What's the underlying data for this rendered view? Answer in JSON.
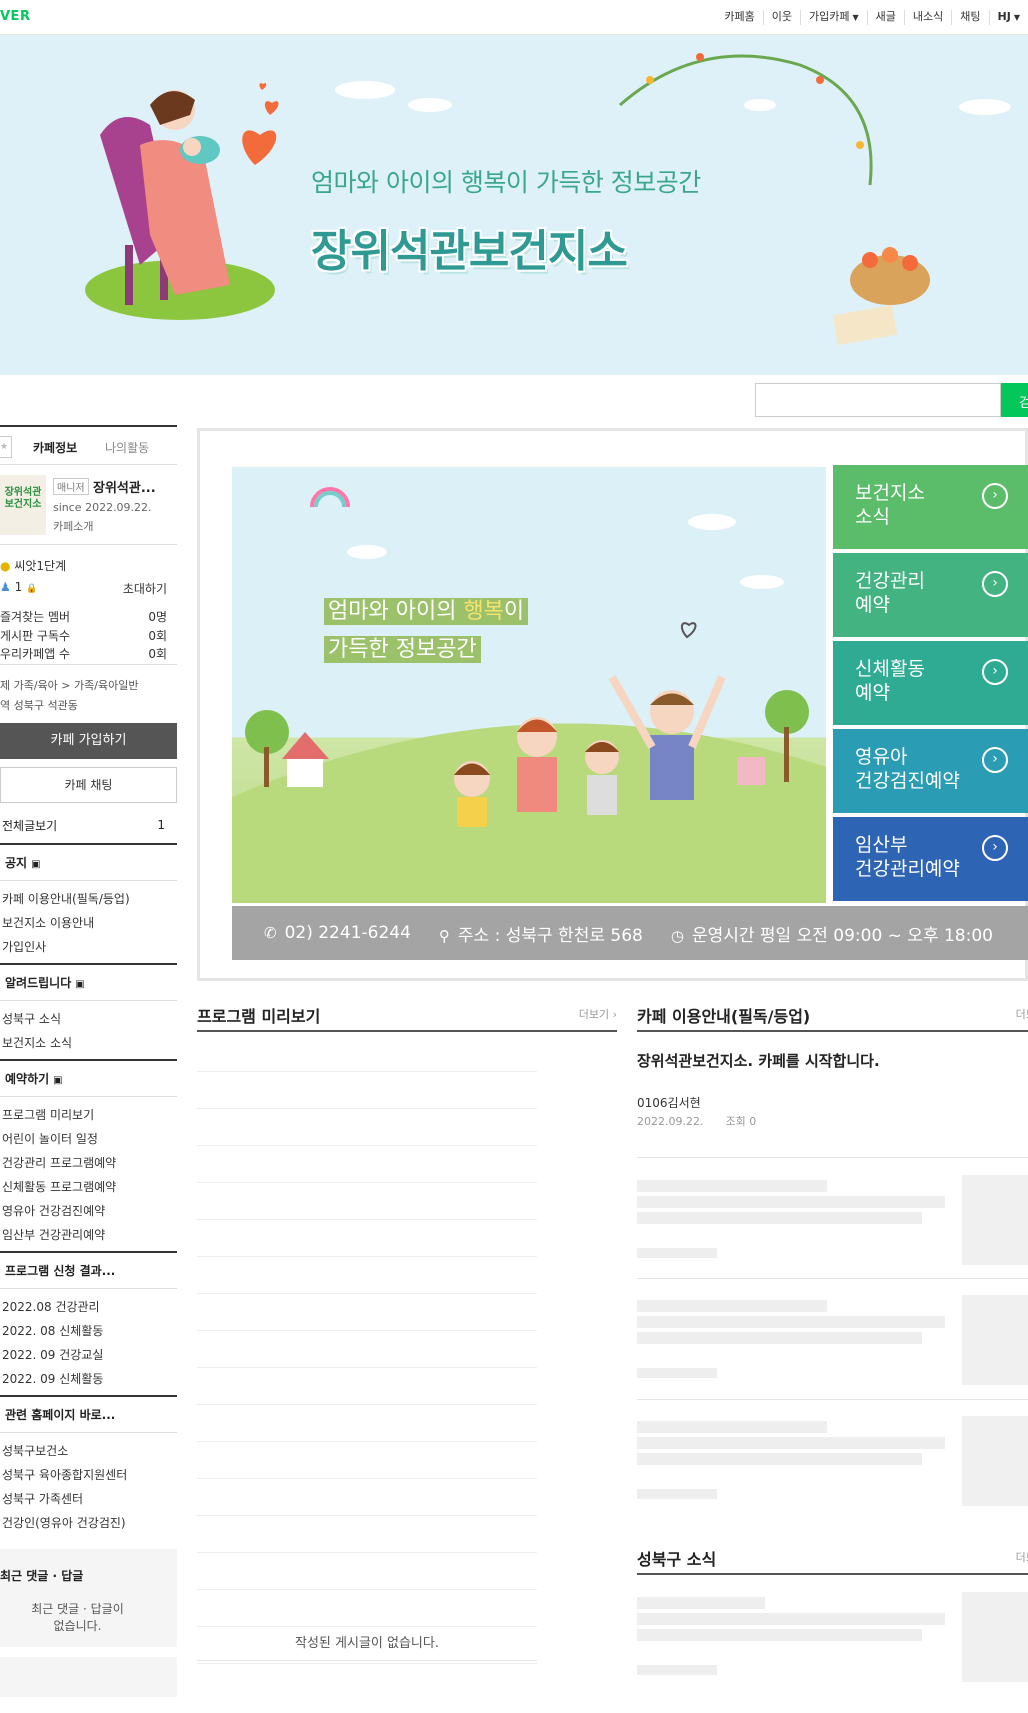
{
  "topbar": {
    "logo": "VER",
    "nav": [
      "카페홈",
      "이웃",
      "가입카페",
      "새글",
      "내소식",
      "채팅",
      "HJ"
    ]
  },
  "banner": {
    "subtitle": "엄마와 아이의 행복이 가득한 정보공간",
    "title": "장위석관보건지소"
  },
  "search": {
    "button": "검색",
    "placeholder": ""
  },
  "sidebar": {
    "tabs": {
      "active": "카페정보",
      "inactive": "나의활동"
    },
    "profile": {
      "thumb_text": "장위석관\n보건지소",
      "badge": "매니저",
      "name": "장위석관...",
      "since": "since 2022.09.22.",
      "intro": "카페소개"
    },
    "level": "씨앗1단계",
    "members": "1",
    "invite": "초대하기",
    "stats": [
      {
        "label": "즐겨찾는 멤버",
        "value": "0명"
      },
      {
        "label": "게시판 구독수",
        "value": "0회"
      },
      {
        "label": "우리카페앱 수",
        "value": "0회"
      }
    ],
    "category_line1": "제  가족/육아 > 가족/육아일반",
    "category_line2": "역  성북구 석관동",
    "join_button": "카페 가입하기",
    "chat_button": "카페 채팅",
    "all_posts": {
      "label": "전체글보기",
      "count": "1"
    },
    "groups": [
      {
        "title": "공지",
        "items": [
          "카페 이용안내(필독/등업)",
          "보건지소 이용안내",
          "가입인사"
        ]
      },
      {
        "title": "알려드립니다",
        "items": [
          "성북구 소식",
          "보건지소 소식"
        ]
      },
      {
        "title": "예약하기",
        "items": [
          "프로그램 미리보기",
          "어린이 놀이터 일정",
          "건강관리 프로그램예약",
          "신체활동 프로그램예약",
          "영유아 건강검진예약",
          "임산부 건강관리예약"
        ]
      },
      {
        "title": "프로그램 신청 결과...",
        "items": [
          "2022.08 건강관리",
          "2022. 08 신체활동",
          "2022. 09 건강교실",
          "2022. 09 신체활동"
        ]
      },
      {
        "title": "관련 홈페이지 바로...",
        "items": [
          "성북구보건소",
          "성북구 육아종합지원센터",
          "성북구 가족센터",
          "건강인(영유아 건강검진)"
        ]
      }
    ],
    "recent": {
      "title": "최근 댓글 · 답글",
      "empty_line1": "최근 댓글 · 답글이",
      "empty_line2": "없습니다."
    }
  },
  "main": {
    "illustration_text_line1_a": "엄마와 아이의 ",
    "illustration_text_line1_b": "행복",
    "illustration_text_line1_c": "이",
    "illustration_text_line2": "가득한 정보공간",
    "quick_buttons": [
      {
        "line1": "보건지소",
        "line2": "소식",
        "color": "#5bbd6a"
      },
      {
        "line1": "건강관리",
        "line2": "예약",
        "color": "#43b381"
      },
      {
        "line1": "신체활동",
        "line2": "예약",
        "color": "#2fab93"
      },
      {
        "line1": "영유아",
        "line2": "건강검진예약",
        "color": "#2a9db5"
      },
      {
        "line1": "임산부",
        "line2": "건강관리예약",
        "color": "#2e64b4"
      }
    ],
    "info": {
      "phone": "02) 2241-6244",
      "address": "주소 : 성북구 한천로 568",
      "hours": "운영시간  평일 오전 09:00 ~ 오후 18:00"
    }
  },
  "boards": {
    "program": {
      "title": "프로그램 미리보기",
      "more": "더보기",
      "empty": "작성된 게시글이 없습니다."
    },
    "notice": {
      "title": "카페 이용안내(필독/등업)",
      "more": "더보기",
      "post_title": "장위석관보건지소. 카페를 시작합니다.",
      "author": "0106김서현",
      "date": "2022.09.22.",
      "views": "조회 0"
    },
    "district": {
      "title": "성북구 소식",
      "more": "더보기"
    }
  },
  "colors": {
    "naver_green": "#03c75a",
    "banner_bg": "#dff1f8",
    "title_teal": "#2e9a93"
  }
}
